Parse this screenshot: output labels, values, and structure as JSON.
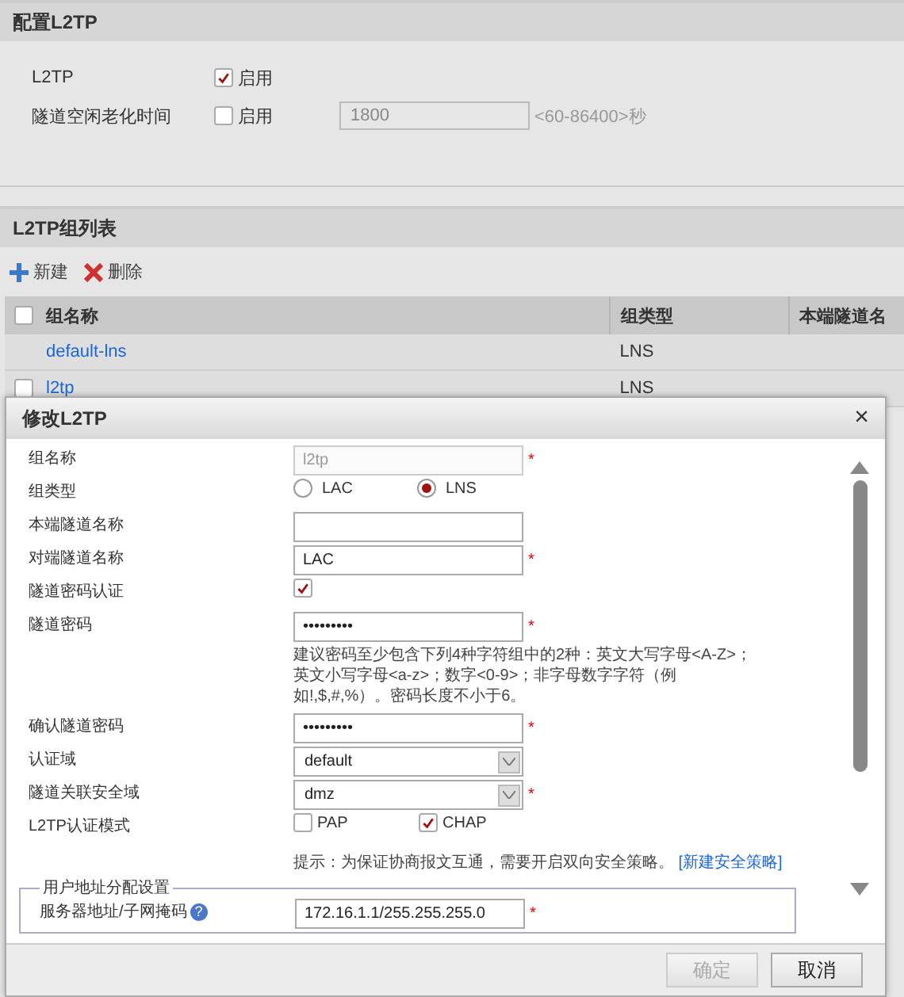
{
  "page_title": "配置L2TP",
  "settings": [
    {
      "label": "L2TP",
      "checkbox_label": "启用",
      "checked": true
    },
    {
      "label": "隧道空闲老化时间",
      "checkbox_label": "启用",
      "checked": false,
      "value": "1800",
      "range": "<60-86400>秒"
    }
  ],
  "list_section": {
    "title": "L2TP组列表",
    "toolbar": [
      {
        "kind": "add",
        "label": "新建"
      },
      {
        "kind": "delete",
        "label": "删除"
      }
    ],
    "select_all_checked": false,
    "columns": [
      "组名称",
      "组类型",
      "本端隧道名"
    ],
    "rows": [
      {
        "kind": "fixed",
        "name": "default-lns",
        "type": "LNS"
      },
      {
        "kind": "normal",
        "checked": false,
        "name": "l2tp",
        "type": "LNS"
      }
    ]
  },
  "dialog": {
    "title": "修改L2TP",
    "close": "×",
    "fields": [
      {
        "kind": "text",
        "label": "组名称",
        "value": "l2tp",
        "disabled": true,
        "mark": "*"
      },
      {
        "kind": "radio",
        "label": "组类型",
        "options": [
          {
            "label": "LAC",
            "selected": false
          },
          {
            "label": "LNS",
            "selected": true
          }
        ]
      },
      {
        "kind": "text",
        "label": "本端隧道名称",
        "disabled": false
      },
      {
        "kind": "text",
        "label": "对端隧道名称",
        "value": "LAC",
        "disabled": false,
        "mark": "*"
      },
      {
        "kind": "checkbox",
        "label": "隧道密码认证",
        "checked": true
      },
      {
        "kind": "text",
        "label": "隧道密码",
        "value": "•••••••••",
        "disabled": false,
        "mark": "*"
      },
      {
        "kind": "hint",
        "text": "建议密码至少包含下列4种字符组中的2种：英文大写字母<A-Z>；英文小写字母<a-z>；数字<0-9>；非字母数字字符（例如!,$,#,%）。密码长度不小于6。"
      },
      {
        "kind": "text",
        "label": "确认隧道密码",
        "value": "•••••••••",
        "disabled": false,
        "mark": "*"
      },
      {
        "kind": "select",
        "label": "认证域",
        "value": "default"
      },
      {
        "kind": "select",
        "label": "隧道关联安全域",
        "value": "dmz",
        "mark": "*"
      },
      {
        "kind": "checkgroup",
        "label": "L2TP认证模式",
        "options": [
          {
            "label": "PAP",
            "checked": false
          },
          {
            "label": "CHAP",
            "checked": true
          }
        ]
      },
      {
        "kind": "note",
        "text": "提示：为保证协商报文互通，需要开启双向安全策略。",
        "link": "[新建安全策略]"
      }
    ],
    "fieldset": {
      "legend": "用户地址分配设置",
      "label": "服务器地址/子网掩码",
      "help": "?",
      "value": "172.16.1.1/255.255.255.0",
      "mark": "*"
    },
    "buttons": [
      {
        "label": "确定",
        "disabled": true
      },
      {
        "label": "取消",
        "disabled": false
      }
    ]
  }
}
